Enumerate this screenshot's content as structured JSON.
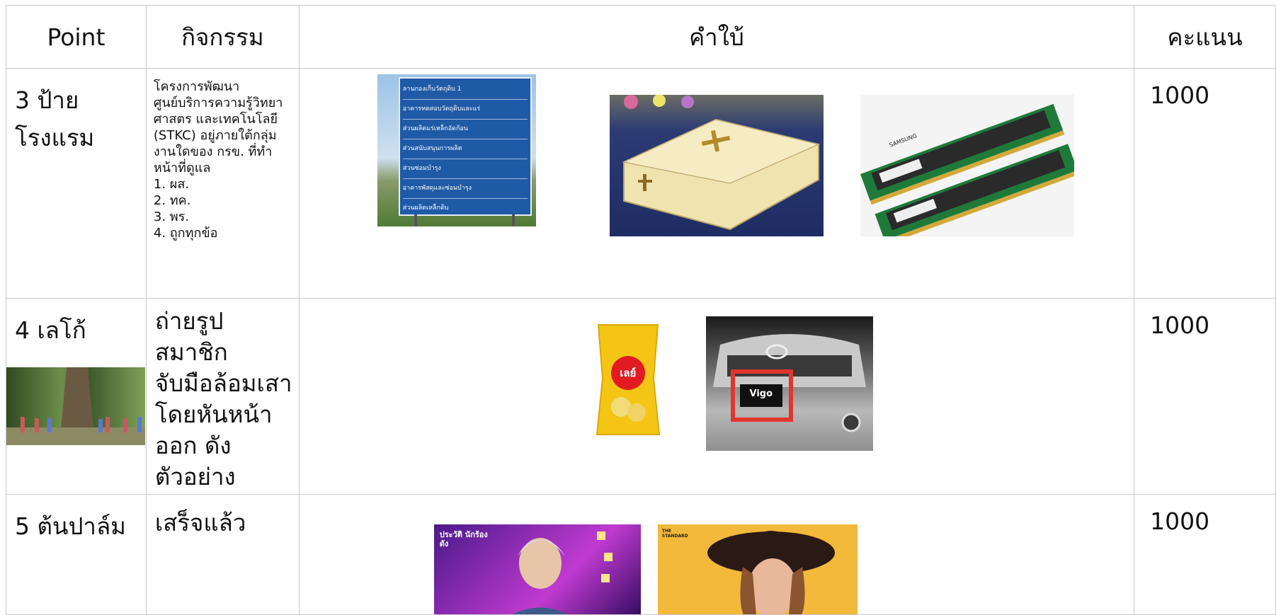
{
  "headers": {
    "point": "Point",
    "activity": "กิจกรรม",
    "clue": "คำใบ้",
    "score": "คะแนน"
  },
  "rows": [
    {
      "point": "3 ป้ายโรงแรม",
      "activity": "โครงการพัฒนา\nศูนย์บริการความรู้วิทยา\nศาสตร และเทคโนโลยี\n(STKC) อยู่ภายใต้กลุ่ม\nงานใดของ กรข. ที่ทำ\nหน้าที่ดูแล\n1. ผส.\n2. ทค.\n3. พร.\n4. ถูกทุกข้อ",
      "score": "1000",
      "sign": {
        "lines": [
          "ลานกองเก็บวัตถุดิบ 1",
          "อาคารทดสอบวัตถุดิบและแร่",
          "ส่วนผลิตแร่เหล็กอัดก้อน",
          "ส่วนสนับสนุนการผลิต",
          "ส่วนซ่อมบำรุง",
          "อาคารพัสดุและซ่อมบำรุง",
          "ส่วนผลิตเหล็กดิบ"
        ]
      },
      "ram_label": "SAMSUNG"
    },
    {
      "point": "4 เลโก้",
      "activity": "ถ่ายรูปสมาชิก\nจับมือล้อมเสา\nโดยหันหน้า\nออก ดัง\nตัวอย่าง",
      "score": "1000",
      "chips_label": "เลย์",
      "plate_label": "Vigo"
    },
    {
      "point": "5 ต้นปาล์ม",
      "activity": "เสร็จแล้ว",
      "score": "1000",
      "tv_label": "ประวัติ นักร้องดัง",
      "magazine_label": "THE STANDARD"
    }
  ],
  "colors": {
    "grid": "#c8c8c8",
    "sign_blue": "#1f5aa6",
    "chips_yellow": "#f5c515",
    "plate_red": "#e0362c"
  }
}
